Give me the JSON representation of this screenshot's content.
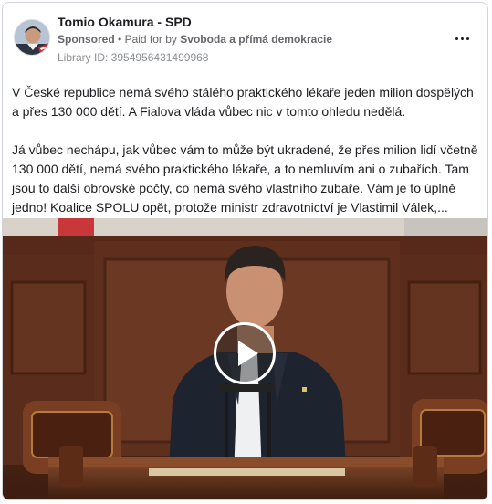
{
  "ad": {
    "page_name": "Tomio Okamura - SPD",
    "sponsored_label": "Sponsored",
    "separator": "•",
    "paid_for_prefix": "Paid for by",
    "funder": "Svoboda a přímá demokracie",
    "library_id": "Library ID: 3954956431499968",
    "more_icon": "more-options-icon"
  },
  "body": {
    "paragraph_1": "V České republice nemá svého stálého praktického lékaře jeden milion dospělých a přes 130 000 dětí. A Fialova vláda vůbec nic v tomto ohledu nedělá.",
    "paragraph_2": "Já vůbec nechápu, jak vůbec vám to může být ukradené, že přes milion lidí včetně 130 000 dětí, nemá svého praktického lékaře, a to nemluvím ani o zubařích. Tam jsou to další obrovské počty, co nemá svého vlastního zubaře. Vám je to úplně jedno! Koalice SPOLU opět, protože ministr zdravotnictví je Vlastimil Válek,..."
  },
  "media": {
    "type": "video",
    "play_icon": "play-icon"
  },
  "colors": {
    "text_primary": "#1c1e21",
    "text_secondary": "#65676b",
    "border": "#d0d3d8",
    "wood": "#5a2e1c"
  }
}
